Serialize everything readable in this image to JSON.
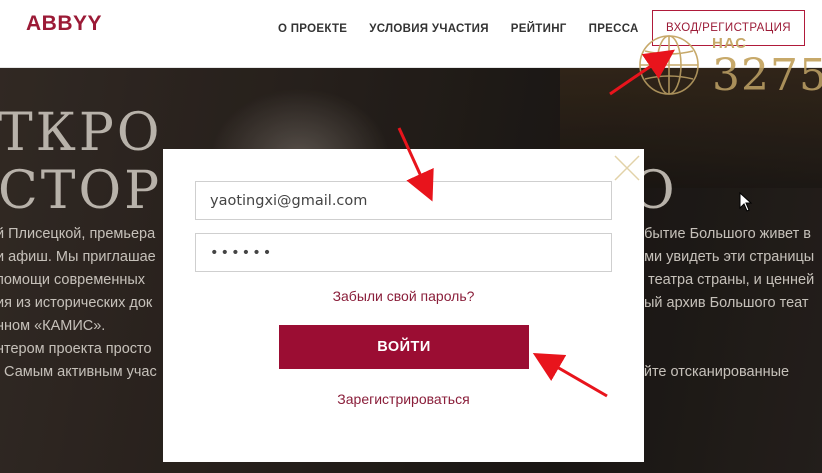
{
  "header": {
    "logo": "ABBYY",
    "nav": [
      "О ПРОЕКТЕ",
      "УСЛОВИЯ УЧАСТИЯ",
      "РЕЙТИНГ",
      "ПРЕССА"
    ],
    "login_label": "ВХОД/РЕГИСТРАЦИЯ"
  },
  "hero": {
    "title_line1": "ТКРО",
    "title_line2": "СТОРИ",
    "title_line2_right": "О",
    "text_left": [
      "й Плисецкой, премьера",
      "и афиш. Мы приглашае",
      "помощи современных",
      "ия из исторических док",
      "нном «КАМИС».",
      "",
      "нтером проекта просто",
      ". Самым активным учас"
    ],
    "text_right": [
      "обытие Большого живет в",
      "ами увидеть эти страницы",
      "о театра страны, и ценней",
      "ный архив Большого теат",
      "",
      "",
      "яйте отсканированные",
      ""
    ],
    "counter_label": "НАС",
    "counter_value": "3275"
  },
  "login_modal": {
    "email_value": "yaotingxi@gmail.com",
    "email_placeholder": "",
    "password_value": "••••••",
    "forgot_label": "Забыли свой пароль?",
    "submit_label": "ВОЙТИ",
    "register_label": "Зарегистрироваться"
  },
  "colors": {
    "brand": "#9b0d33",
    "link": "#8a1e3a",
    "annotation_arrow": "#e8141c"
  }
}
